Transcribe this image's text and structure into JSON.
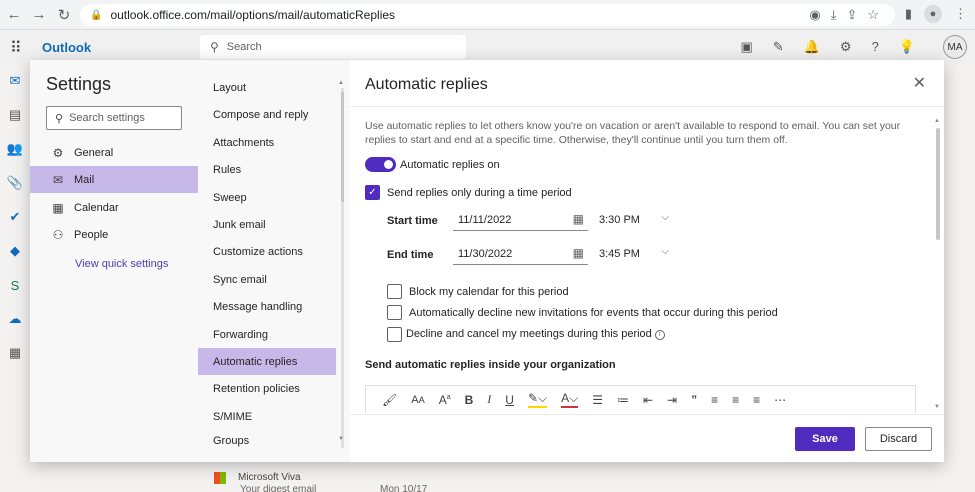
{
  "browser": {
    "url": "outlook.office.com/mail/options/mail/automaticReplies"
  },
  "outlook": {
    "brand": "Outlook",
    "search_placeholder": "Search",
    "avatar_initials": "MA"
  },
  "background_mail": {
    "from": "Microsoft Viva",
    "subject": "Your digest email",
    "date": "Mon 10/17"
  },
  "settings": {
    "title": "Settings",
    "search_placeholder": "Search settings",
    "categories": [
      {
        "label": "General",
        "icon": "gear-icon"
      },
      {
        "label": "Mail",
        "icon": "mail-icon"
      },
      {
        "label": "Calendar",
        "icon": "calendar-icon"
      },
      {
        "label": "People",
        "icon": "people-icon"
      }
    ],
    "quick_settings": "View quick settings",
    "subcategories": [
      "Layout",
      "Compose and reply",
      "Attachments",
      "Rules",
      "Sweep",
      "Junk email",
      "Customize actions",
      "Sync email",
      "Message handling",
      "Forwarding",
      "Automatic replies",
      "Retention policies",
      "S/MIME",
      "Groups"
    ]
  },
  "pane": {
    "title": "Automatic replies",
    "description": "Use automatic replies to let others know you're on vacation or aren't available to respond to email. You can set your replies to start and end at a specific time. Otherwise, they'll continue until you turn them off.",
    "toggle_label": "Automatic replies on",
    "time_period_label": "Send replies only during a time period",
    "start_label": "Start time",
    "start_date": "11/11/2022",
    "start_time": "3:30 PM",
    "end_label": "End time",
    "end_date": "11/30/2022",
    "end_time": "3:45 PM",
    "options": [
      "Block my calendar for this period",
      "Automatically decline new invitations for events that occur during this period",
      "Decline and cancel my meetings during this period"
    ],
    "section_heading": "Send automatic replies inside your organization",
    "save": "Save",
    "discard": "Discard"
  },
  "colors": {
    "accent": "#4f2bbf",
    "selected": "#c7b8ea"
  }
}
